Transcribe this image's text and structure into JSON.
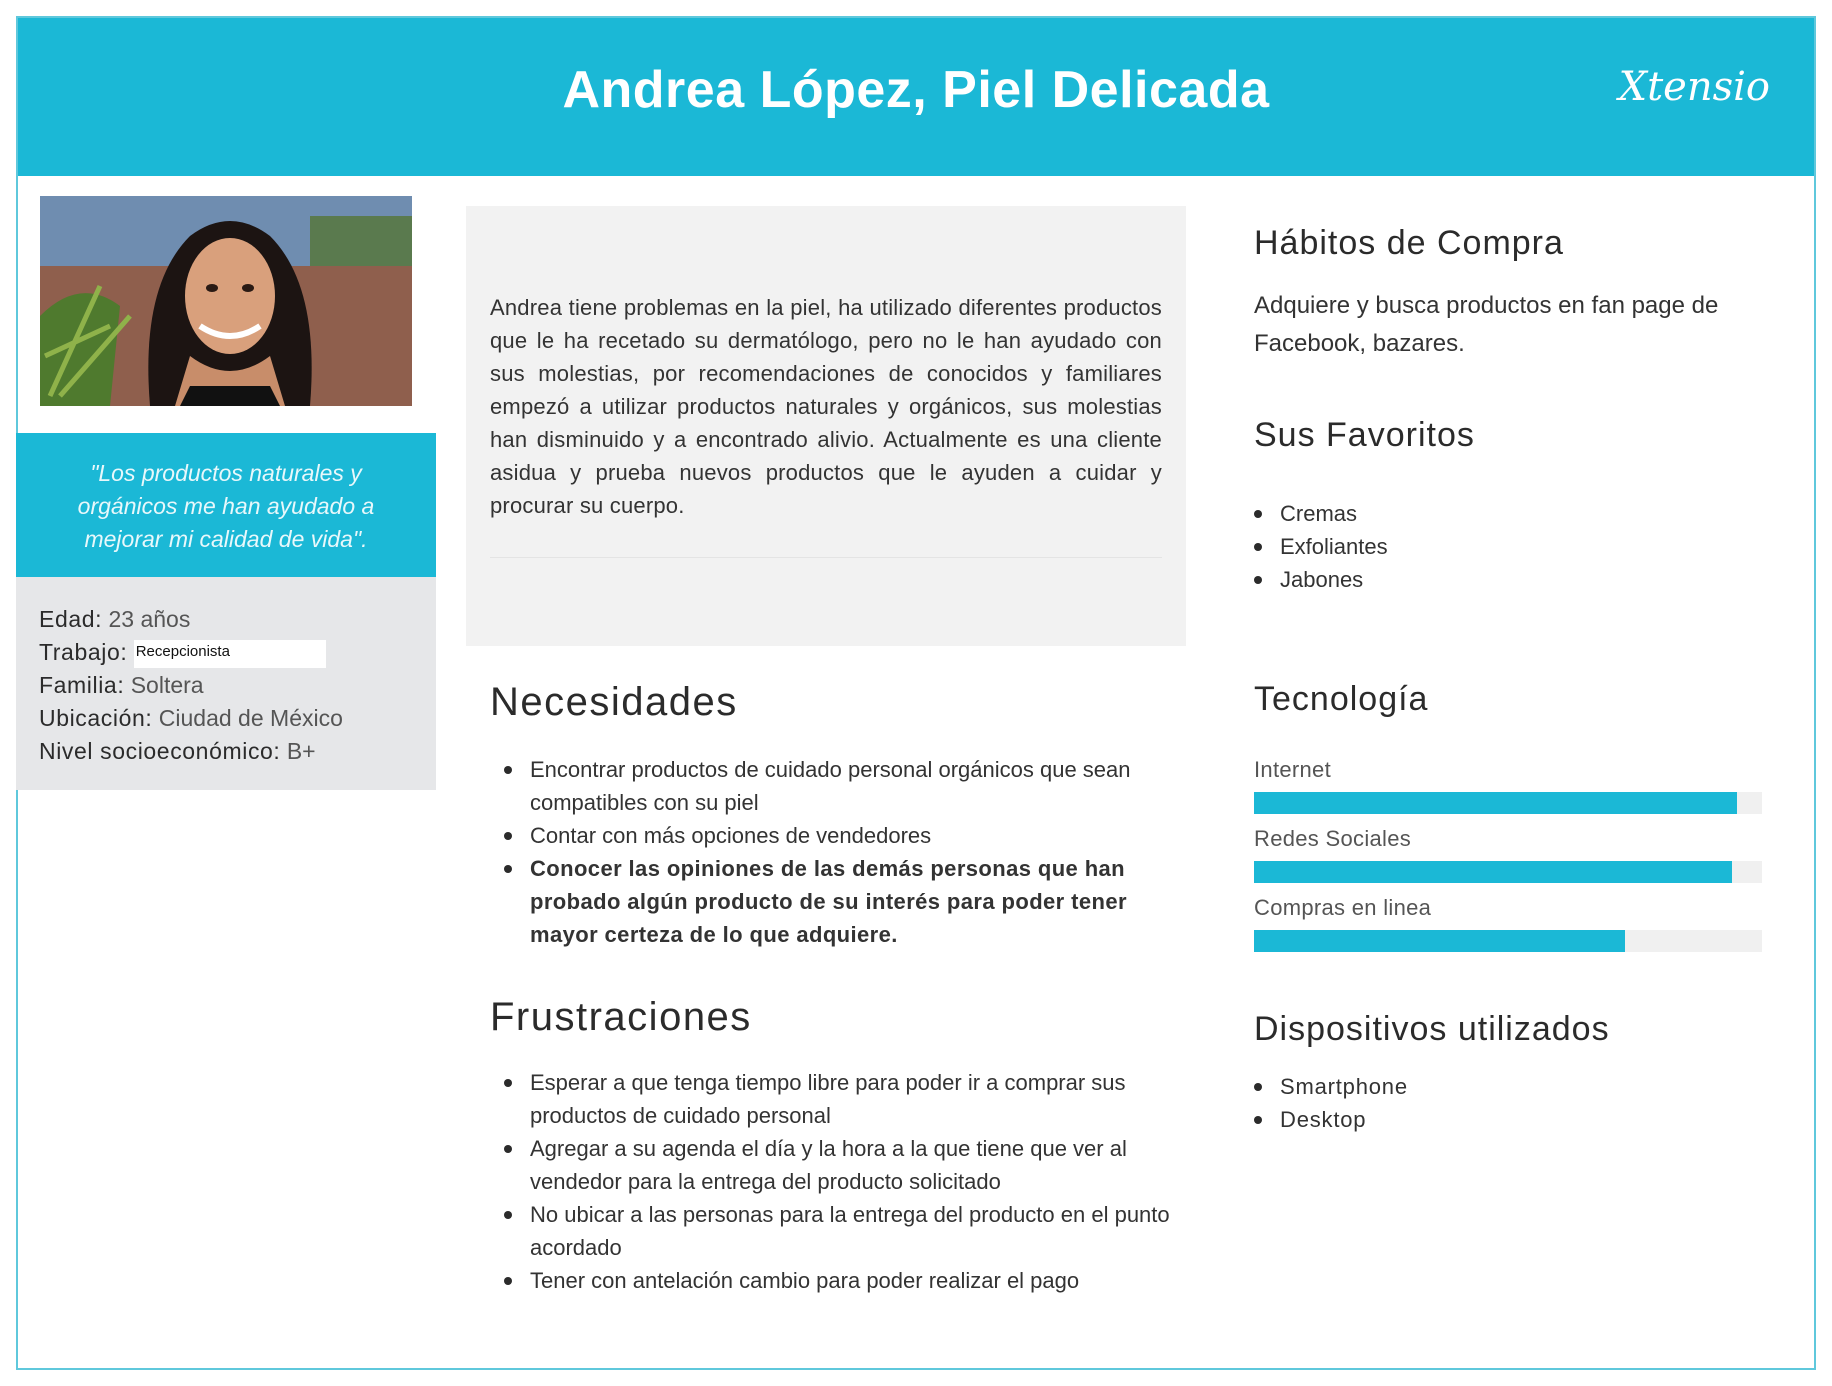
{
  "header": {
    "title": "Andrea López, Piel Delicada",
    "brand": "Xtensio"
  },
  "profile": {
    "quote": "\"Los productos naturales  y orgánicos me han ayudado a mejorar mi calidad de vida\".",
    "details": [
      {
        "key": "Edad:",
        "value": "23 años"
      },
      {
        "key": "Trabajo:",
        "value": "Recepcionista"
      },
      {
        "key": "Familia:",
        "value": "Soltera"
      },
      {
        "key": "Ubicación:",
        "value": "Ciudad de México"
      },
      {
        "key": "Nivel socioeconómico:",
        "value": "B+"
      }
    ]
  },
  "bio": "Andrea tiene problemas en la piel, ha utilizado diferentes productos que le ha recetado su dermatólogo, pero no le han ayudado con sus molestias, por recomendaciones de conocidos y familiares empezó a utilizar productos naturales y orgánicos, sus molestias han disminuido y a encontrado alivio. Actualmente es una cliente asidua y  prueba nuevos productos que le ayuden a cuidar y procurar su cuerpo.",
  "needs": {
    "title": "Necesidades",
    "items": [
      "Encontrar productos de cuidado personal orgánicos que sean compatibles con su piel",
      "Contar con más opciones de vendedores",
      "Conocer las opiniones de las demás personas que han probado algún producto de su interés para poder tener mayor certeza de lo que adquiere."
    ]
  },
  "frustrations": {
    "title": "Frustraciones",
    "items": [
      "Esperar a que tenga tiempo libre para poder ir a comprar sus productos de cuidado personal",
      "Agregar a su agenda el día y la hora a la que tiene que ver al vendedor para la entrega del producto solicitado",
      "No ubicar a las personas para la entrega del producto en el punto acordado",
      "Tener con antelación cambio para poder realizar el pago"
    ]
  },
  "habits": {
    "title": "Hábitos de Compra",
    "text": "Adquiere y busca productos en fan page de Facebook, bazares."
  },
  "favorites": {
    "title": "Sus Favoritos",
    "items": [
      "Cremas",
      "Exfoliantes",
      "Jabones"
    ]
  },
  "technology": {
    "title": "Tecnología",
    "bars": [
      {
        "label": "Internet",
        "level": 0.95
      },
      {
        "label": "Redes Sociales",
        "level": 0.94
      },
      {
        "label": "Compras en linea",
        "level": 0.73
      }
    ]
  },
  "devices": {
    "title": "Dispositivos utilizados",
    "items": [
      "Smartphone",
      "Desktop"
    ]
  },
  "colors": {
    "accent": "#1bb8d6",
    "panel": "#e6e7e9",
    "bio_bg": "#f2f2f2"
  }
}
